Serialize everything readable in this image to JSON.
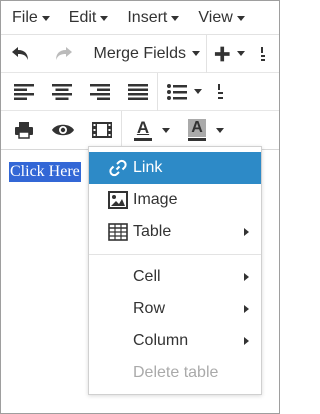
{
  "menubar": {
    "items": [
      {
        "label": "File"
      },
      {
        "label": "Edit"
      },
      {
        "label": "Insert"
      },
      {
        "label": "View"
      }
    ]
  },
  "toolbar": {
    "merge_fields_label": "Merge Fields",
    "icons": {
      "undo": "undo-icon",
      "redo": "redo-icon",
      "insert": "plus-icon",
      "align_left": "align-left-icon",
      "align_center": "align-center-icon",
      "align_right": "align-right-icon",
      "align_justify": "align-justify-icon",
      "bullet_list": "bullet-list-icon",
      "numbered_list": "numbered-list-icon",
      "print": "print-icon",
      "preview": "eye-icon",
      "media": "film-icon",
      "text_color": "text-color-icon",
      "bg_color": "background-color-icon"
    },
    "text_color_letter": "A",
    "bg_color_letter": "A"
  },
  "content": {
    "selected_text": "Click Here"
  },
  "context_menu": {
    "items": [
      {
        "label": "Link",
        "icon": "link-icon",
        "active": true
      },
      {
        "label": "Image",
        "icon": "image-icon"
      },
      {
        "label": "Table",
        "icon": "table-icon",
        "submenu": true
      },
      {
        "label": "Cell",
        "submenu": true
      },
      {
        "label": "Row",
        "submenu": true
      },
      {
        "label": "Column",
        "submenu": true
      },
      {
        "label": "Delete table",
        "disabled": true
      }
    ]
  },
  "colors": {
    "active_item_bg": "#2d8ac7",
    "selection_bg": "#3367d6",
    "disabled_text": "#aaaaaa"
  }
}
